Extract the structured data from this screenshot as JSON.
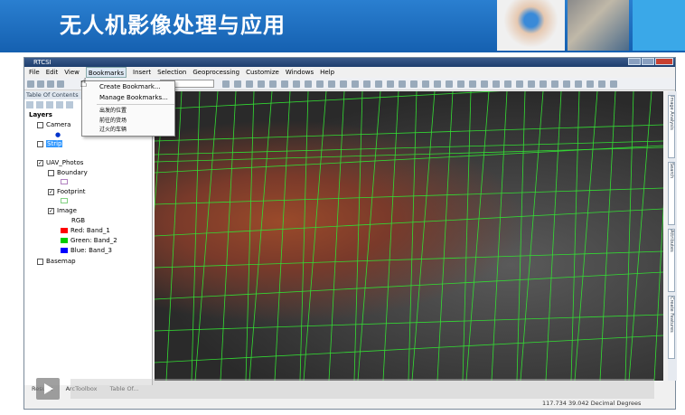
{
  "banner": {
    "title": "无人机影像处理与应用"
  },
  "window": {
    "title": "RTCSI"
  },
  "menubar": [
    "File",
    "Edit",
    "View",
    "Bookmarks",
    "Insert",
    "Selection",
    "Geoprocessing",
    "Customize",
    "Windows",
    "Help"
  ],
  "toolbar": {
    "scale_value": "00"
  },
  "bookmarks_menu": {
    "items": [
      "Create Bookmark...",
      "Manage Bookmarks...",
      "出发的位置",
      "前往的货场",
      "过火的车辆"
    ]
  },
  "toc": {
    "title": "Table Of Contents",
    "layers": "Layers",
    "camera": "Camera",
    "strip": "Strip",
    "uav": "UAV_Photos",
    "boundary": "Boundary",
    "footprint": "Footprint",
    "image": "Image",
    "rgb": "RGB",
    "red": "Red:   Band_1",
    "green": "Green: Band_2",
    "blue": "Blue:  Band_3",
    "basemap": "Basemap"
  },
  "colors": {
    "red": "#ff0000",
    "green": "#00cc00",
    "blue": "#0000ff",
    "footprint_lines": "#33dd33"
  },
  "right_dock": [
    "Image Analysis",
    "Search",
    "Attributes",
    "Create Features"
  ],
  "status": {
    "tabs": [
      "Results",
      "ArcToolbox",
      "Table Of..."
    ],
    "coords": "117.734  39.042 Decimal Degrees"
  }
}
